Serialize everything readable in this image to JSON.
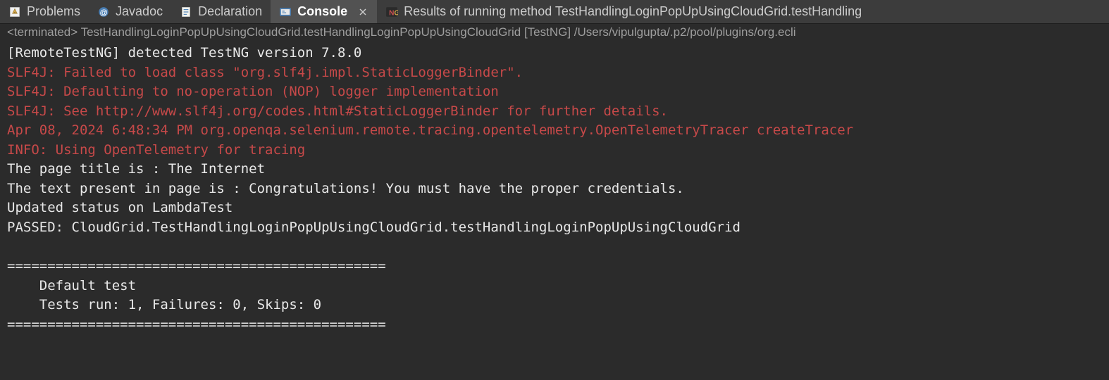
{
  "tabs": {
    "problems": "Problems",
    "javadoc": "Javadoc",
    "declaration": "Declaration",
    "console": "Console",
    "results": "Results of running method TestHandlingLoginPopUpUsingCloudGrid.testHandling"
  },
  "status_line": "<terminated> TestHandlingLoginPopUpUsingCloudGrid.testHandlingLoginPopUpUsingCloudGrid [TestNG] /Users/vipulgupta/.p2/pool/plugins/org.ecli",
  "console": {
    "lines": [
      {
        "text": "[RemoteTestNG] detected TestNG version 7.8.0",
        "color": "white"
      },
      {
        "text": "SLF4J: Failed to load class \"org.slf4j.impl.StaticLoggerBinder\".",
        "color": "red"
      },
      {
        "text": "SLF4J: Defaulting to no-operation (NOP) logger implementation",
        "color": "red"
      },
      {
        "text": "SLF4J: See http://www.slf4j.org/codes.html#StaticLoggerBinder for further details.",
        "color": "red"
      },
      {
        "text": "Apr 08, 2024 6:48:34 PM org.openqa.selenium.remote.tracing.opentelemetry.OpenTelemetryTracer createTracer",
        "color": "red"
      },
      {
        "text": "INFO: Using OpenTelemetry for tracing",
        "color": "red"
      },
      {
        "text": "The page title is : The Internet",
        "color": "white"
      },
      {
        "text": "The text present in page is : Congratulations! You must have the proper credentials.",
        "color": "white"
      },
      {
        "text": "Updated status on LambdaTest",
        "color": "white"
      },
      {
        "text": "PASSED: CloudGrid.TestHandlingLoginPopUpUsingCloudGrid.testHandlingLoginPopUpUsingCloudGrid",
        "color": "white"
      },
      {
        "text": "",
        "color": "white"
      },
      {
        "text": "===============================================",
        "color": "white"
      },
      {
        "text": "    Default test",
        "color": "white"
      },
      {
        "text": "    Tests run: 1, Failures: 0, Skips: 0",
        "color": "white"
      },
      {
        "text": "===============================================",
        "color": "white"
      }
    ]
  }
}
